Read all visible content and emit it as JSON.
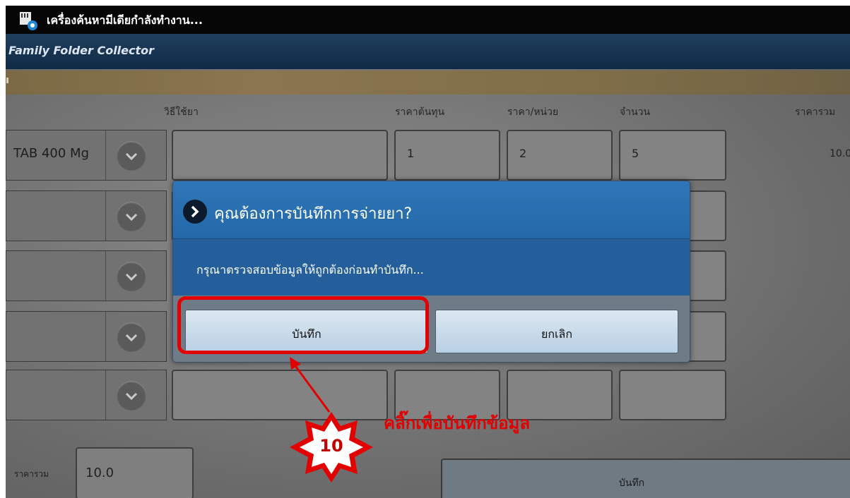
{
  "status_bar": {
    "text": "เครื่องค้นหามีเดียกำลังทำงาน..."
  },
  "app_bar": {
    "title": "Family Folder Collector"
  },
  "columns": {
    "usage": "วิธีใช้ยา",
    "cost": "ราคาต้นทุน",
    "unit_price": "ราคา/หน่วย",
    "quantity": "จำนวน",
    "total": "ราคารวม"
  },
  "rows": [
    {
      "drug": "TAB 400 Mg",
      "usage": "",
      "cost": "1",
      "unit_price": "2",
      "quantity": "5",
      "total": "10.0"
    },
    {
      "drug": "",
      "usage": "",
      "cost": "",
      "unit_price": "",
      "quantity": "",
      "total": ""
    },
    {
      "drug": "",
      "usage": "",
      "cost": "",
      "unit_price": "",
      "quantity": "",
      "total": ""
    },
    {
      "drug": "",
      "usage": "",
      "cost": "",
      "unit_price": "",
      "quantity": "",
      "total": ""
    },
    {
      "drug": "",
      "usage": "",
      "cost": "",
      "unit_price": "",
      "quantity": "",
      "total": ""
    }
  ],
  "summary": {
    "label": "ราคารวม",
    "value": "10.0"
  },
  "bottom_button": {
    "label": "บันทึก"
  },
  "dialog": {
    "title": "คุณต้องการบันทึกการจ่ายยา?",
    "message": "กรุณาตรวจสอบข้อมูลให้ถูกต้องก่อนทำบันทึก...",
    "confirm_label": "บันทึก",
    "cancel_label": "ยกเลิก"
  },
  "annotation": {
    "callout_text": "คลิ๊กเพื่อบันทึกข้อมูล",
    "step_number": "10",
    "color": "#e20000"
  },
  "icons": [
    "media-scanner-icon",
    "chevron-down-icon",
    "chevron-right-icon"
  ]
}
